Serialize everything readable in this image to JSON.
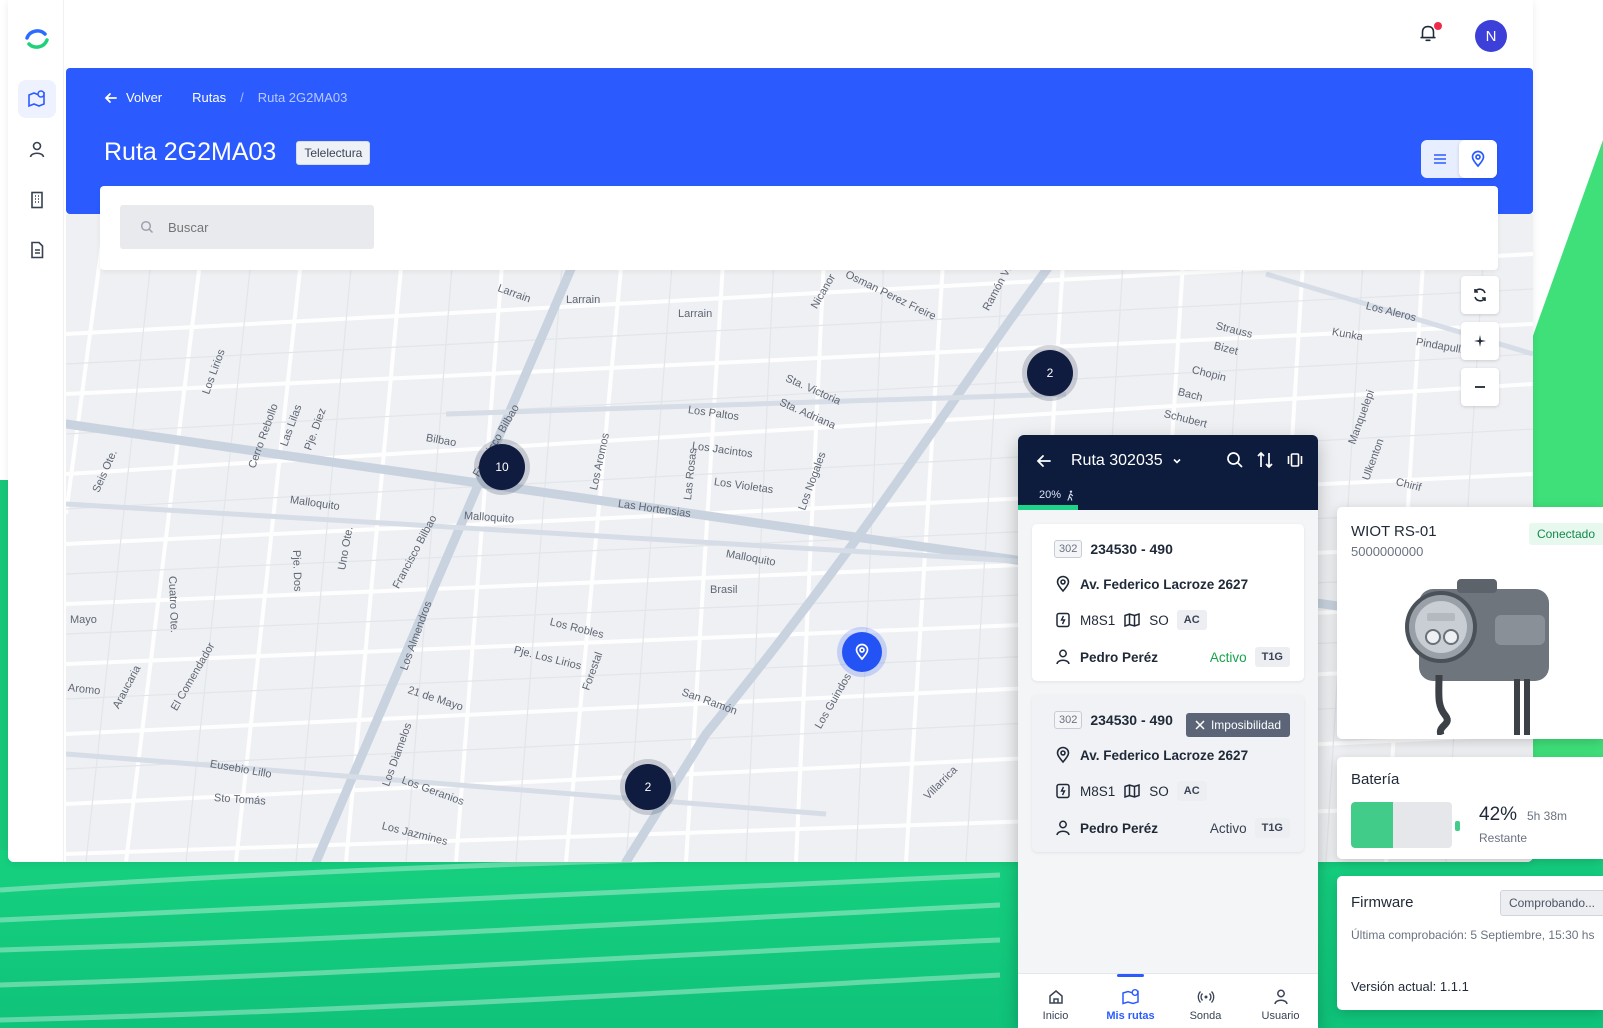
{
  "header": {
    "back_label": "Volver",
    "breadcrumb_parent": "Rutas",
    "breadcrumb_separator": "/",
    "breadcrumb_current": "Ruta 2G2MA03",
    "title": "Ruta 2G2MA03",
    "badge": "Telelectura"
  },
  "topbar": {
    "avatar_initial": "N"
  },
  "search": {
    "placeholder": "Buscar"
  },
  "map": {
    "clusters": [
      "10",
      "2",
      "2"
    ],
    "street_labels": [
      "Larrain",
      "Larrain",
      "Larrain",
      "Osman Perez Freire",
      "Nicanor",
      "Ramón Vi",
      "Strauss",
      "Bizet",
      "Chopin",
      "Bach",
      "Schubert",
      "Los Aleros",
      "Kunka",
      "Pindapulli",
      "Los Paltos",
      "Sta. Victoria",
      "Sta. Adriana",
      "Los Jacintos",
      "Los Violetas",
      "Las Hortensias",
      "Los Nogales",
      "Bilbao",
      "Francisco Bilbao",
      "Francisco Bilbao",
      "Malloquito",
      "Malloquito",
      "Malloquito",
      "Los Lirios",
      "Las Lilas",
      "Pje. Diez",
      "Cerro Rebollo",
      "Seis Ote.",
      "Cuatro Ote.",
      "Pje. Dos",
      "Uno Ote.",
      "Brasil",
      "Los Robles",
      "Pje. Los Lirios",
      "San Ramón",
      "Los Guindos",
      "Forestal",
      "21 de Mayo",
      "Los Almendros",
      "Los Aromos",
      "Las Rosas",
      "Mayo",
      "Aromo",
      "Araucaria",
      "El Comendador",
      "Eusebio Lillo",
      "Sto Tomás",
      "Los Geranios",
      "Los Diamelos",
      "Los Jazmines",
      "Villarrica",
      "Chirif",
      "Ulkenton",
      "Manquelepi"
    ]
  },
  "phone": {
    "title": "Ruta 302035",
    "progress_label": "20%",
    "progress": 0.2,
    "cards": [
      {
        "code": "302",
        "id": "234530 - 490",
        "address": "Av. Federico Lacroze 2627",
        "meter": "M8S1",
        "zone": "SO",
        "tag": "AC",
        "person": "Pedro Peréz",
        "status": "Activo",
        "tariff": "T1G",
        "flag": ""
      },
      {
        "code": "302",
        "id": "234530 - 490",
        "address": "Av. Federico Lacroze 2627",
        "meter": "M8S1",
        "zone": "SO",
        "tag": "AC",
        "person": "Pedro Peréz",
        "status": "Activo",
        "tariff": "T1G",
        "flag": "Imposibilidad"
      }
    ],
    "nav": [
      "Inicio",
      "Mis rutas",
      "Sonda",
      "Usuario"
    ]
  },
  "device": {
    "name": "WIOT RS-01",
    "serial": "5000000000",
    "status": "Conectado"
  },
  "battery": {
    "title": "Batería",
    "percent_label": "42%",
    "level": 0.42,
    "time": "5h 38m",
    "remaining": "Restante"
  },
  "firmware": {
    "title": "Firmware",
    "status": "Comprobando...",
    "last_check": "Última comprobación: 5 Septiembre, 15:30 hs",
    "version": "Versión actual: 1.1.1"
  },
  "colors": {
    "primary": "#2b5bff",
    "navy": "#0d1b3d",
    "green": "#1fd28a"
  }
}
